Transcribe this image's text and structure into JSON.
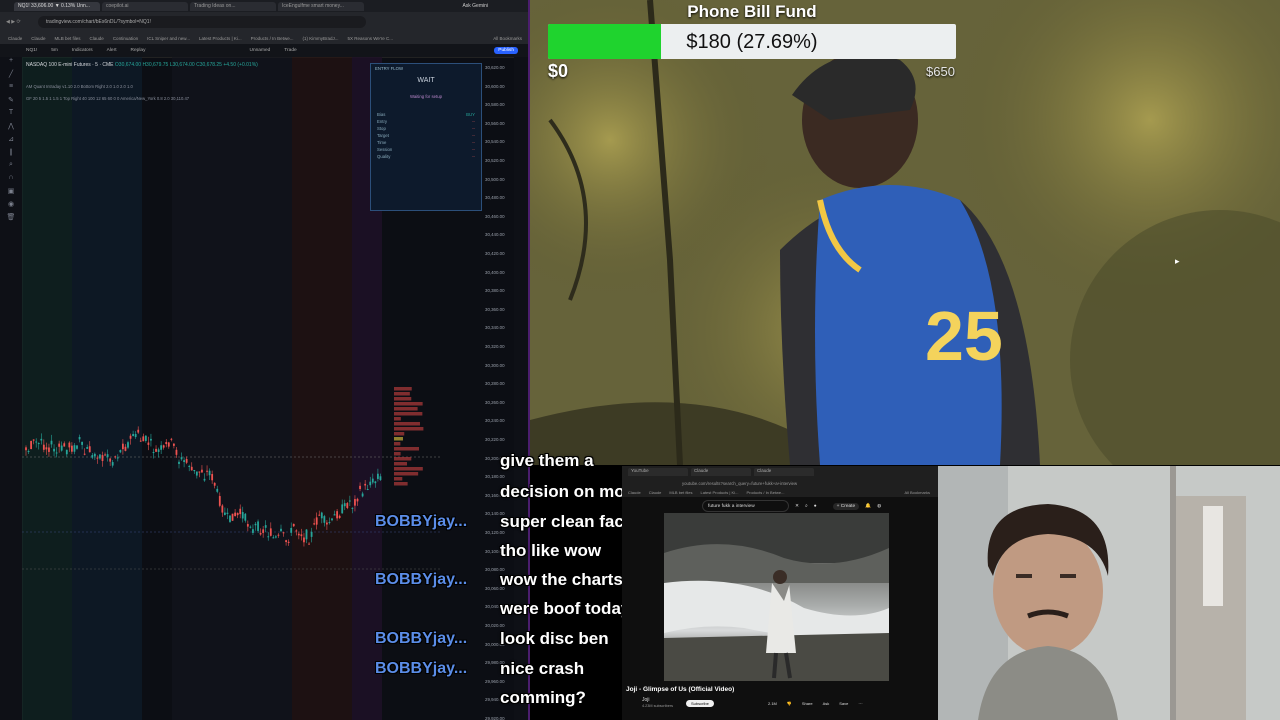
{
  "browser": {
    "tabs": [
      "NQ1! 33,606.00 ▼ 0.13% Unn...",
      "coepilot.ai",
      "Trading Ideas on...",
      "IceEngulfme smart money...",
      "Ask Gemini"
    ],
    "url": "tradingview.com/chart/bEs6nDL/?symbol=NQ1!",
    "bookmarks": [
      "Claude",
      "Claude",
      "MLB bet files",
      "Claude",
      "Continuation",
      "ICL Sniper and new...",
      "Latest Products | Ki...",
      "Products / In Betwe...",
      "(1) KimmyBradJ...",
      "5X Reasons We're C..."
    ],
    "all_bookmarks": "All Bookmarks"
  },
  "toolbar": {
    "symbol": "NQ1!",
    "interval": "5m",
    "indicators": "Indicators",
    "alert": "Alert",
    "replay": "Replay",
    "layout": "Unnamed",
    "trade": "Trade",
    "publish": "Publish"
  },
  "chart": {
    "legend_title": "NASDAQ 100 E-mini Futures · 5 · CME",
    "legend_values": "O30,674.00 H30,679.75 L30,674.00 C30,678.25 +4.50 (+0.01%)",
    "legend_line2": "AM Quant Intraday v1.10 2.0 Bottom Right 2.0 1.0 2.0 1.0",
    "legend_line3": "GF 20 5 1.5 1 1.5 1 Top Right 40 100 12 65 60 0 0 America/New_York 0.8 2.0 30,110.47",
    "price_axis": [
      "30,620.00",
      "30,600.00",
      "30,580.00",
      "30,560.00",
      "30,540.00",
      "30,520.00",
      "30,500.00",
      "30,480.00",
      "30,460.00",
      "30,440.00",
      "30,420.00",
      "30,400.00",
      "30,380.00",
      "30,360.00",
      "30,340.00",
      "30,320.00",
      "30,300.00",
      "30,280.00",
      "30,260.00",
      "30,240.00",
      "30,220.00",
      "30,200.00",
      "30,180.00",
      "30,160.00",
      "30,140.00",
      "30,120.00",
      "30,100.00",
      "30,080.00",
      "30,060.00",
      "30,040.00",
      "30,020.00",
      "30,000.00",
      "29,980.00",
      "29,960.00",
      "29,940.00",
      "29,920.00"
    ],
    "entry_panel": {
      "title": "ENTRY FLOW",
      "state": "WAIT",
      "message": "Waiting for setup",
      "rows": [
        {
          "label": "Bias",
          "value": "BUY"
        },
        {
          "label": "Entry",
          "value": "--"
        },
        {
          "label": "Stop",
          "value": "--"
        },
        {
          "label": "Target",
          "value": "--"
        },
        {
          "label": "Time",
          "value": "--"
        },
        {
          "label": "Session",
          "value": "--"
        },
        {
          "label": "Quality",
          "value": "--"
        }
      ]
    },
    "colors": {
      "up": "#26a69a",
      "down": "#ef5350"
    }
  },
  "goal": {
    "title": "Phone Bill Fund",
    "amount_text": "$180 (27.69%)",
    "progress": 0.2769,
    "start_label": "$0",
    "end_label": "$650",
    "colors": {
      "fill": "#1fd32e",
      "track": "#eceff0"
    }
  },
  "chat": {
    "messages": [
      "give them a",
      "decision on monday",
      "super clean facility",
      "tho like wow",
      "wow the charts",
      "were boof today",
      "look disc ben",
      "nice crash",
      "comming?"
    ],
    "users": [
      "BOBBYjay...",
      "BOBBYjay...",
      "BOBBYjay...",
      "BOBBYjay..."
    ]
  },
  "youtube": {
    "tabs": [
      "YouTube",
      "Claude",
      "Claude"
    ],
    "url": "youtube.com/results?search_query=future+fukk+a+interview",
    "bookmarks": [
      "Claude",
      "Claude",
      "MLB bet files",
      "Latest Products | Ki...",
      "Products / In Betwe..."
    ],
    "all_bookmarks": "All Bookmarks",
    "search": "future fukk a interview",
    "create": "+ Create",
    "video_title": "Joji - Glimpse of Us (Official Video)",
    "channel": "Joji",
    "subscribers": "4.23M subscribers",
    "subscribe": "Subscribe",
    "actions": [
      "2.1M",
      "Share",
      "Ask",
      "Save"
    ]
  }
}
